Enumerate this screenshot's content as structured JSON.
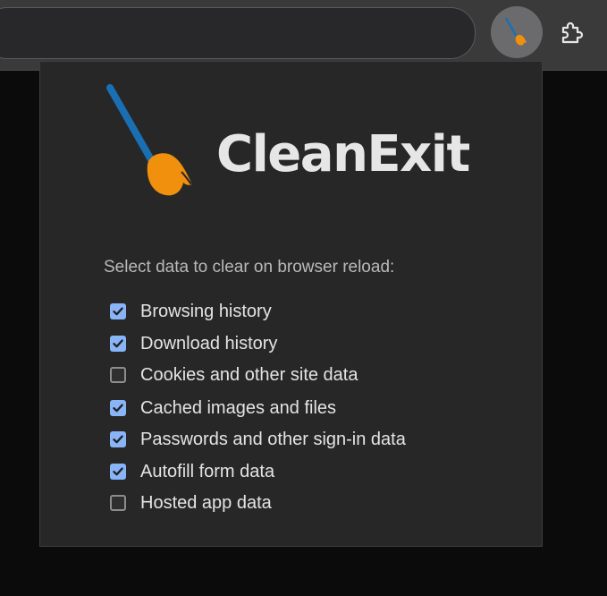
{
  "popup": {
    "brand": "CleanExit",
    "instructions": "Select data to clear on browser reload:",
    "options": [
      {
        "label": "Browsing history",
        "checked": true
      },
      {
        "label": "Download history",
        "checked": true
      },
      {
        "label": "Cookies and other site data",
        "checked": false
      },
      {
        "label": "Cached images and files",
        "checked": true
      },
      {
        "label": "Passwords and other sign-in data",
        "checked": true
      },
      {
        "label": "Autofill form data",
        "checked": true
      },
      {
        "label": "Hosted app data",
        "checked": false
      }
    ]
  },
  "toolbar": {
    "extension_icon": "broom-icon",
    "extensions_menu_icon": "puzzle-icon"
  },
  "colors": {
    "checkbox_accent": "#8ab4f8",
    "broom_handle": "#1a6fb3",
    "broom_head": "#f0900c"
  }
}
